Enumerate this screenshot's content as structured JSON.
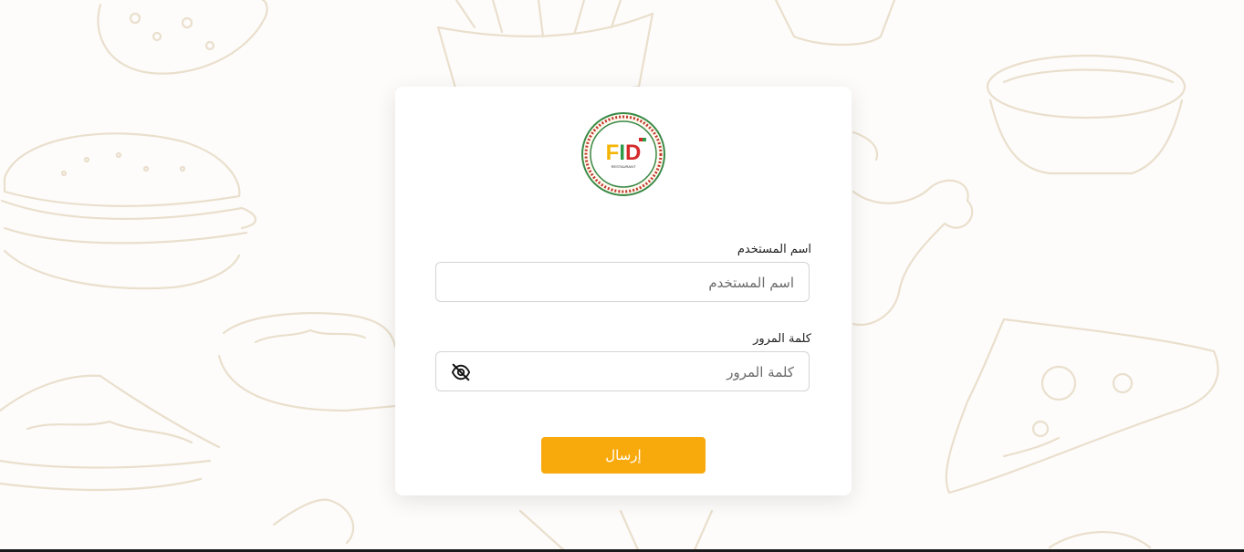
{
  "logo": {
    "text": "FID",
    "subtext": "RESTAURANT"
  },
  "form": {
    "username_label": "اسم المستخدم",
    "username_placeholder": "اسم المستخدم",
    "username_value": "",
    "password_label": "كلمة المرور",
    "password_placeholder": "كلمة المرور",
    "password_value": "",
    "password_toggle_icon": "eye-slash-icon",
    "submit_label": "إرسال"
  },
  "colors": {
    "accent": "#f8a90c",
    "sketch": "#eadfcd",
    "logo_ring": "#3a8a46",
    "logo_inner_ring": "#c0392b"
  }
}
